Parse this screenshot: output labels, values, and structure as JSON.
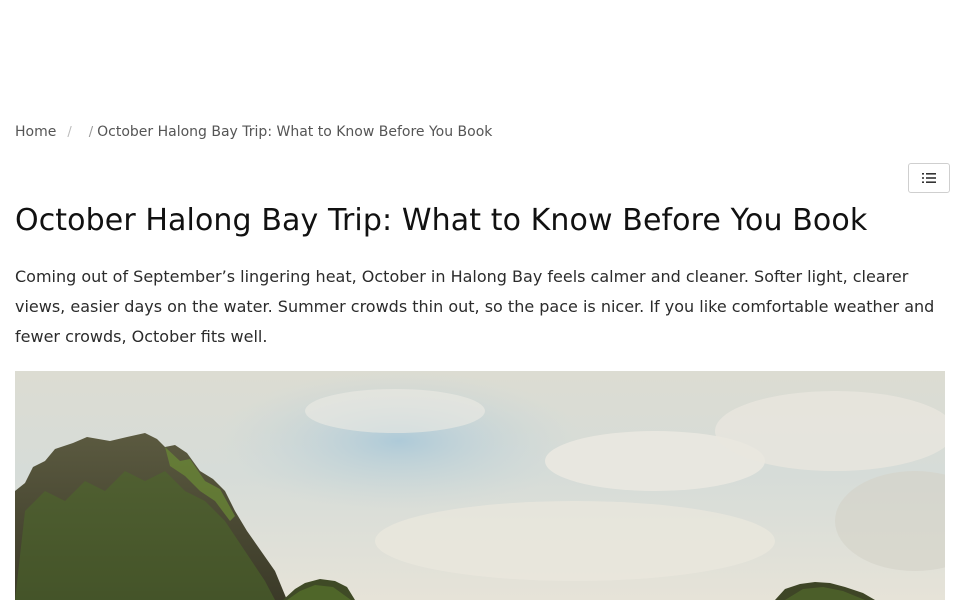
{
  "breadcrumb": {
    "home_label": "Home",
    "separator_1": "/",
    "separator_2": "/",
    "current_label": "October Halong Bay Trip: What to Know Before You Book"
  },
  "toc": {
    "icon": "list-icon"
  },
  "article": {
    "title": "October Halong Bay Trip: What to Know Before You Book",
    "intro": "Coming out of September’s lingering heat, October in Halong Bay feels calmer and cleaner. Softer light, clearer views, easier days on the water. Summer crowds thin out, so the pace is nicer. If you like comfortable weather and fewer crowds, October fits well."
  },
  "hero_image": {
    "subject": "limestone karst islands under a pale cloudy sky"
  }
}
